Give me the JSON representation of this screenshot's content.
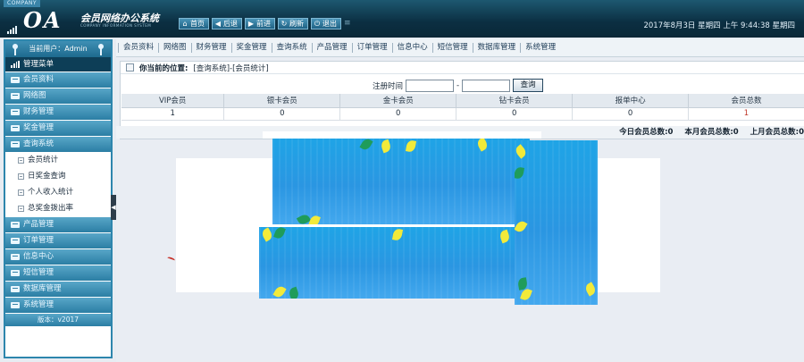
{
  "header": {
    "company": "COMPANY",
    "logo_text": "OA",
    "system_name": "会员网络办公系统",
    "system_subtitle": "COMPANY INFORMATION SYSTEM",
    "nav": [
      {
        "label": "首页",
        "icon": "home-icon",
        "glyph": "⌂"
      },
      {
        "label": "后退",
        "icon": "back-icon",
        "glyph": "◀"
      },
      {
        "label": "前进",
        "icon": "forward-icon",
        "glyph": "▶"
      },
      {
        "label": "刷新",
        "icon": "refresh-icon",
        "glyph": "↻"
      },
      {
        "label": "退出",
        "icon": "power-icon",
        "glyph": "⏻"
      }
    ],
    "datetime": "2017年8月3日 星期四 上午 9:44:38 星期四"
  },
  "sidebar": {
    "user_label": "当前用户：Admin",
    "menu_title": "管理菜单",
    "items_top": [
      "会员资料",
      "网络图",
      "财务管理",
      "奖金管理",
      "查询系统"
    ],
    "sub_items": [
      "会员统计",
      "日奖金查询",
      "个人收入统计",
      "总奖金拨出率"
    ],
    "items_bottom": [
      "产品管理",
      "订单管理",
      "信息中心",
      "短信管理",
      "数据库管理",
      "系统管理"
    ],
    "version": "版本：v2017"
  },
  "tabs": [
    "会员资料",
    "网络图",
    "财务管理",
    "奖金管理",
    "查询系统",
    "产品管理",
    "订单管理",
    "信息中心",
    "短信管理",
    "数据库管理",
    "系统管理"
  ],
  "content": {
    "location_label": "你当前的位置:",
    "location_path": "[查询系统]-[会员统计]",
    "filter_label": "注册时间",
    "filter_sep": "-",
    "filter_start": "",
    "filter_end": "",
    "query_button": "查询",
    "table": {
      "headers": [
        "VIP会员",
        "银卡会员",
        "金卡会员",
        "钻卡会员",
        "报单中心",
        "会员总数"
      ],
      "rows": [
        [
          "1",
          "0",
          "0",
          "0",
          "0",
          "1"
        ]
      ]
    },
    "summary": [
      "今日会员总数:0",
      "本月会员总数:0",
      "上月会员总数:0"
    ]
  },
  "colors": {
    "header_bg": "#0b2f42",
    "menu_blue": "#2b7ea4",
    "popup_blue": "#2a96e2",
    "leaf_yellow": "#f2ea3a",
    "leaf_green": "#1f9c5a",
    "total_red": "#c0392b"
  }
}
